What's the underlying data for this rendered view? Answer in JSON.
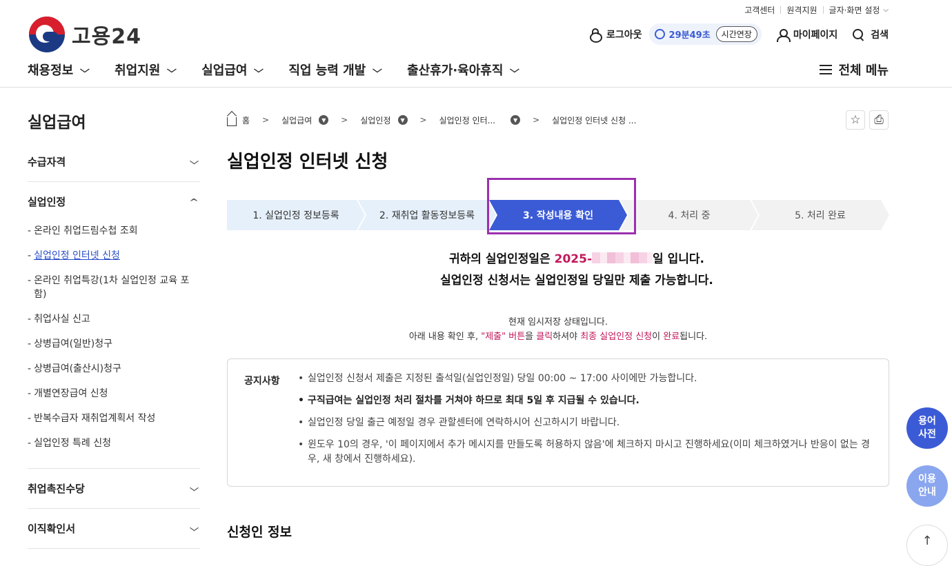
{
  "util": {
    "items": [
      "고객센터",
      "원격지원",
      "글자·화면 설정"
    ]
  },
  "logo": {
    "name": "고용24"
  },
  "header": {
    "logout": "로그아웃",
    "timer": "29분49초",
    "extend": "시간연장",
    "mypage": "마이페이지",
    "search": "검색"
  },
  "gnb": {
    "menus": [
      "채용정보",
      "취업지원",
      "실업급여",
      "직업 능력 개발",
      "출산휴가·육아휴직"
    ],
    "all": "전체 메뉴"
  },
  "lnb": {
    "title": "실업급여",
    "groups": [
      {
        "label": "수급자격"
      },
      {
        "label": "실업인정",
        "items": [
          "온라인 취업드림수첩 조회",
          "실업인정 인터넷 신청",
          "온라인 취업특강(1차 실업인정 교육 포함)",
          "취업사실 신고",
          "상병급여(일반)청구",
          "상병급여(출산시)청구",
          "개별연장급여 신청",
          "반복수급자 재취업계획서 작성",
          "실업인정 특례 신청"
        ]
      },
      {
        "label": "취업촉진수당"
      },
      {
        "label": "이직확인서"
      }
    ]
  },
  "breadcrumb": [
    "홈",
    "실업급여",
    "실업인정",
    "실업인정 인터...",
    "실업인정 인터넷 신청 ..."
  ],
  "page": {
    "title": "실업인정 인터넷 신청"
  },
  "steps": [
    "1. 실업인정 정보등록",
    "2. 재취업 활동정보등록",
    "3. 작성내용 확인",
    "4. 처리 중",
    "5. 처리 완료"
  ],
  "current_step": 3,
  "message": {
    "line1_prefix": "귀하의 실업인정일은 ",
    "date_visible": "2025-",
    "line1_suffix": "일 입니다.",
    "line2": "실업인정 신청서는 실업인정일 당일만 제출 가능합니다."
  },
  "temp": {
    "line1": "현재 임시저장 상태입니다.",
    "l2a": "아래 내용 확인 후, ",
    "l2b": "\"제출\" 버튼",
    "l2c": "을 ",
    "l2d": "클릭",
    "l2e": "하셔야 ",
    "l2f": "최종 실업인정 신청",
    "l2g": "이 ",
    "l2h": "완료",
    "l2i": "됩니다."
  },
  "notice": {
    "label": "공지사항",
    "items": [
      "실업인정 신청서 제출은 지정된 출석일(실업인정일) 당일 00:00 ~ 17:00 사이에만 가능합니다.",
      "구직급여는 실업인정 처리 절차를 거쳐야 하므로 최대 5일 후 지급될 수 있습니다.",
      "실업인정 당일 출근 예정일 경우 관할센터에 연락하시어 신고하시기 바랍니다.",
      "윈도우 10의 경우, '이 페이지에서 추가 메시지를 만들도록 허용하지 않음'에 체크하지 마시고 진행하세요(이미 체크하였거나 반응이 없는 경우, 새 창에서 진행하세요)."
    ]
  },
  "section": {
    "title": "신청인 정보"
  },
  "floating": {
    "dict": "용어\n사전",
    "guide": "이용\n안내",
    "top": "↑"
  },
  "colors": {
    "primary": "#3b5bd6",
    "highlight": "#9b2fae",
    "accent": "#c2185b"
  }
}
